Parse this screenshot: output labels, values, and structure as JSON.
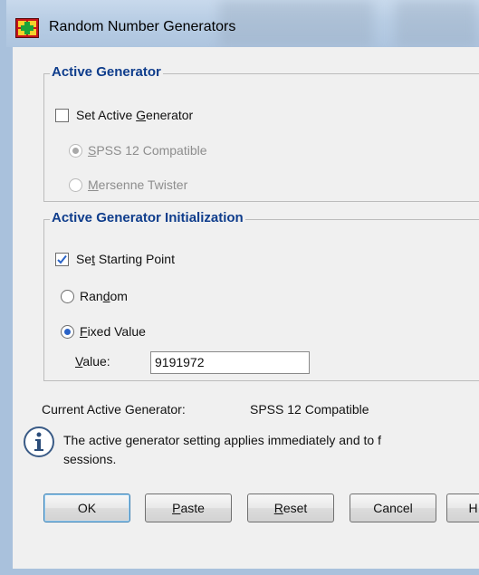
{
  "window": {
    "title": "Random Number Generators"
  },
  "active_generator": {
    "legend": "Active Generator",
    "set_active": {
      "pre": "Set Active ",
      "key": "G",
      "post": "enerator",
      "checked": false
    },
    "opt_spss": {
      "pre": "",
      "key": "S",
      "post": "PSS 12 Compatible",
      "selected": true,
      "enabled": false
    },
    "opt_mersenne": {
      "pre": "",
      "key": "M",
      "post": "ersenne Twister",
      "selected": false,
      "enabled": false
    }
  },
  "initialization": {
    "legend": "Active Generator Initialization",
    "set_starting": {
      "pre": "Se",
      "key": "t",
      "post": " Starting Point",
      "checked": true
    },
    "opt_random": {
      "pre": "Ran",
      "key": "d",
      "post": "om",
      "selected": false
    },
    "opt_fixed": {
      "pre": "",
      "key": "F",
      "post": "ixed Value",
      "selected": true
    },
    "value_label": {
      "pre": "",
      "key": "V",
      "post": "alue:"
    },
    "value": "9191972"
  },
  "current": {
    "label": "Current Active Generator:",
    "value": "SPSS 12 Compatible"
  },
  "info": {
    "line1": "The active generator setting applies immediately and to f",
    "line2": "sessions."
  },
  "buttons": {
    "ok": {
      "pre": "OK",
      "key": "",
      "post": ""
    },
    "paste": {
      "pre": "",
      "key": "P",
      "post": "aste"
    },
    "reset": {
      "pre": "",
      "key": "R",
      "post": "eset"
    },
    "cancel": {
      "pre": "Cancel",
      "key": "",
      "post": ""
    },
    "help": {
      "pre": "H",
      "key": "",
      "post": ""
    }
  },
  "colors": {
    "legend": "#0f3d8c",
    "frame": "#a9c1dc",
    "accent": "#2a63c7"
  }
}
